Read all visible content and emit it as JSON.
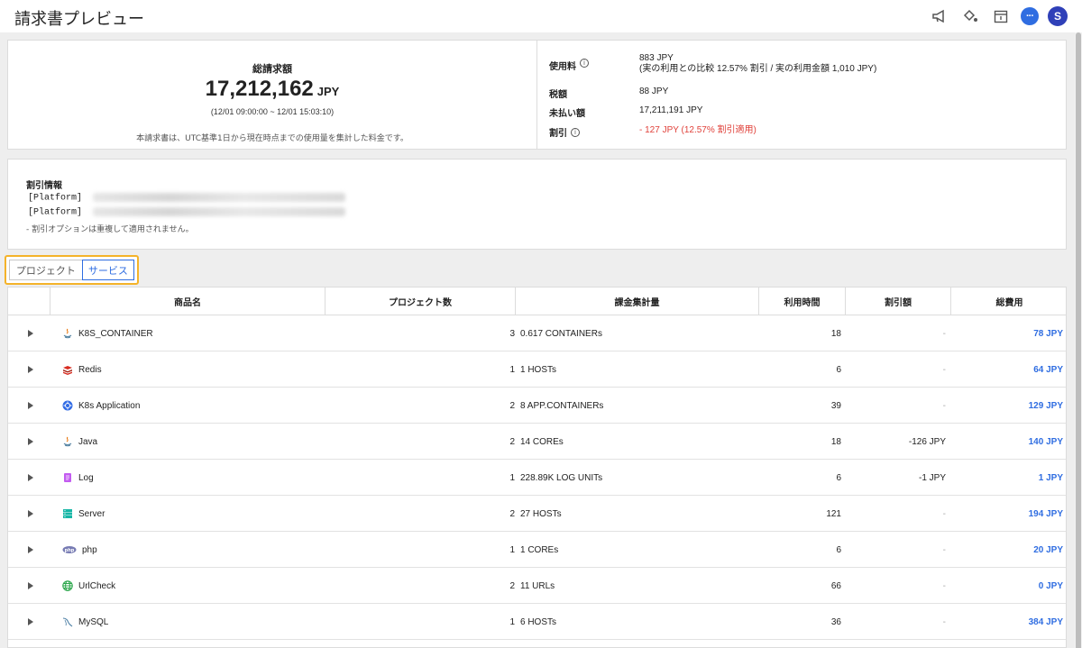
{
  "page": {
    "title": "請求書プレビュー"
  },
  "toolbar": {
    "avatar_initial": "S"
  },
  "summary": {
    "total_label": "総請求額",
    "total_amount": "17,212,162",
    "total_currency": "JPY",
    "period": "(12/01 09:00:00 ~ 12/01 15:03:10)",
    "note": "本請求書は、UTC基準1日から現在時点までの使用量を集計した料金です。",
    "rows": [
      {
        "key": "使用料",
        "value1": "883 JPY",
        "value2": "(実の利用との比較 12.57% 割引 / 実の利用金額 1,010 JPY)"
      },
      {
        "key": "税額",
        "value1": "88 JPY"
      },
      {
        "key": "未払い額",
        "value1": "17,211,191 JPY"
      },
      {
        "key": "割引",
        "value1": "- 127 JPY  (12.57% 割引適用)"
      }
    ]
  },
  "discount": {
    "heading": "割引情報",
    "platform1": "[Platform]",
    "platform2": "[Platform]",
    "note": "- 割引オプションは重複して適用されません。"
  },
  "tabs": {
    "project": "プロジェクト",
    "service": "サービス"
  },
  "table": {
    "headers": [
      "商品名",
      "プロジェクト数",
      "課金集計量",
      "利用時間",
      "割引額",
      "総費用"
    ],
    "rows": [
      {
        "icon": "java-icon",
        "name": "K8S_CONTAINER",
        "projects": "3",
        "usage": "0.617 CONTAINERs",
        "time": "18",
        "discount": "-",
        "total": "78 JPY"
      },
      {
        "icon": "redis-icon",
        "name": "Redis",
        "projects": "1",
        "usage": "1 HOSTs",
        "time": "6",
        "discount": "-",
        "total": "64 JPY"
      },
      {
        "icon": "kubernetes-icon",
        "name": "K8s Application",
        "projects": "2",
        "usage": "8 APP.CONTAINERs",
        "time": "39",
        "discount": "-",
        "total": "129 JPY"
      },
      {
        "icon": "java-icon",
        "name": "Java",
        "projects": "2",
        "usage": "14 COREs",
        "time": "18",
        "discount": "-126 JPY",
        "total": "140 JPY"
      },
      {
        "icon": "log-icon",
        "name": "Log",
        "projects": "1",
        "usage": "228.89K LOG UNITs",
        "time": "6",
        "discount": "-1 JPY",
        "total": "1 JPY"
      },
      {
        "icon": "server-icon",
        "name": "Server",
        "projects": "2",
        "usage": "27 HOSTs",
        "time": "121",
        "discount": "-",
        "total": "194 JPY"
      },
      {
        "icon": "php-icon",
        "name": "php",
        "projects": "1",
        "usage": "1 COREs",
        "time": "6",
        "discount": "-",
        "total": "20 JPY"
      },
      {
        "icon": "globe-icon",
        "name": "UrlCheck",
        "projects": "2",
        "usage": "11 URLs",
        "time": "66",
        "discount": "-",
        "total": "0 JPY"
      },
      {
        "icon": "mysql-icon",
        "name": "MySQL",
        "projects": "1",
        "usage": "6 HOSTs",
        "time": "36",
        "discount": "-",
        "total": "384 JPY"
      }
    ]
  },
  "colors": {
    "accent": "#2f6de1",
    "highlight": "#f4b32a",
    "negative": "#e0413a",
    "avatar": "#2f40b8"
  }
}
